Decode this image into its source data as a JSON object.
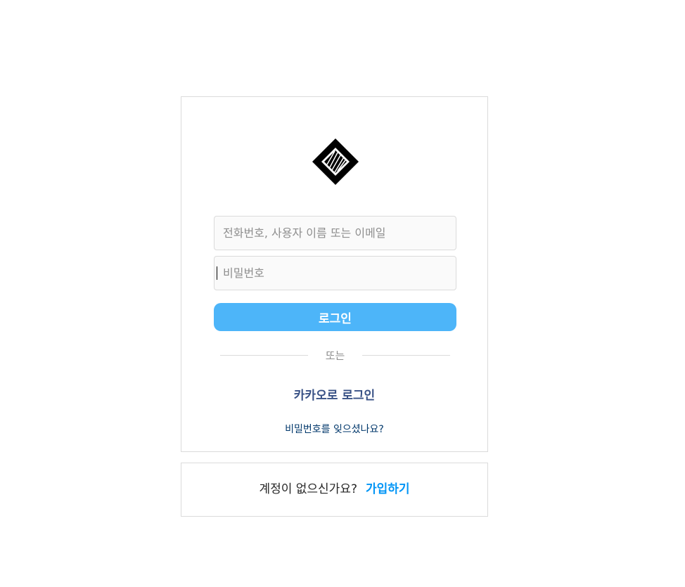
{
  "login": {
    "phone_placeholder": "전화번호, 사용자 이름 또는 이메일",
    "password_placeholder": "비밀번호",
    "login_label": "로그인",
    "divider_label": "또는",
    "kakao_label": "카카오로 로그인",
    "forgot_label": "비밀번호를 잊으셨나요?"
  },
  "signup": {
    "prompt": "계정이 없으신가요?",
    "link_label": "가입하기"
  },
  "colors": {
    "login_button": "#4db5f9",
    "kakao_text": "#385185",
    "forgot_text": "#00376b",
    "signup_link": "#0095f6",
    "border": "#dbdbdb"
  },
  "icons": {
    "logo": "diamond-logo-icon"
  }
}
